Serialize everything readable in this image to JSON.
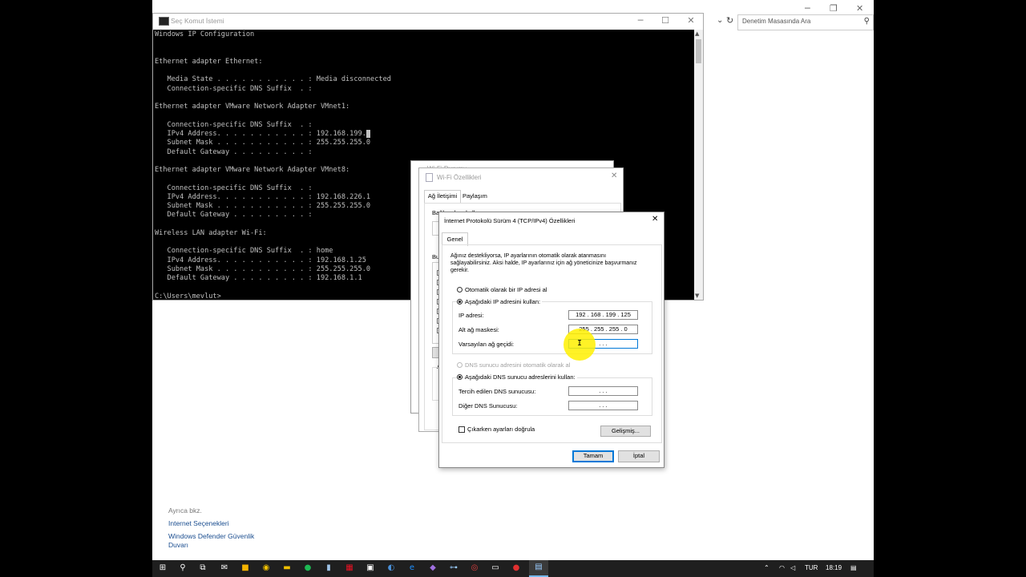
{
  "control_panel": {
    "search_placeholder": "Denetim Masasında Ara",
    "see_also_title": "Ayrıca bkz.",
    "see_also_links": [
      "Internet Seçenekleri",
      "Windows Defender Güvenlik",
      "Duvarı"
    ]
  },
  "cmd": {
    "title": "Seç Komut İstemi",
    "lines": [
      "Windows IP Configuration",
      "",
      "",
      "Ethernet adapter Ethernet:",
      "",
      "   Media State . . . . . . . . . . . : Media disconnected",
      "   Connection-specific DNS Suffix  . :",
      "",
      "Ethernet adapter VMware Network Adapter VMnet1:",
      "",
      "   Connection-specific DNS Suffix  . :",
      "   IPv4 Address. . . . . . . . . . . : 192.168.199.",
      "   Subnet Mask . . . . . . . . . . . : 255.255.255.0",
      "   Default Gateway . . . . . . . . . :",
      "",
      "Ethernet adapter VMware Network Adapter VMnet8:",
      "",
      "   Connection-specific DNS Suffix  . :",
      "   IPv4 Address. . . . . . . . . . . : 192.168.226.1",
      "   Subnet Mask . . . . . . . . . . . : 255.255.255.0",
      "   Default Gateway . . . . . . . . . :",
      "",
      "Wireless LAN adapter Wi-Fi:",
      "",
      "   Connection-specific DNS Suffix  . : home",
      "   IPv4 Address. . . . . . . . . . . : 192.168.1.25",
      "   Subnet Mask . . . . . . . . . . . : 255.255.255.0",
      "   Default Gateway . . . . . . . . . : 192.168.1.1",
      "",
      "C:\\Users\\mevlut>"
    ]
  },
  "wifi_status": {
    "title": "Wi-Fi Durumu"
  },
  "wifi_props": {
    "title": "Wi-Fi Özellikleri",
    "tabs": [
      "Ağ İletişimi",
      "Paylaşım"
    ],
    "connect_label": "Bağlanırken kullan:",
    "items_label": "Bu",
    "desc_label": "A"
  },
  "tcp": {
    "title": "İnternet Protokolü Sürüm 4 (TCP/IPv4) Özellikleri",
    "tab": "Genel",
    "description": [
      "Ağınız destekliyorsa, IP ayarlarının otomatik olarak atanmasını",
      "sağlayabilirsiniz. Aksi halde, IP ayarlarınız için ağ yöneticinize başvurmanız",
      "gerekir."
    ],
    "radio_auto_ip": "Otomatik olarak bir IP adresi al",
    "radio_manual_ip": "Aşağıdaki IP adresini kullan:",
    "ip_label": "IP adresi:",
    "ip_value": "192 . 168 . 199 . 125",
    "mask_label": "Alt ağ maskesi:",
    "mask_value": "255 . 255 . 255 .  0",
    "gateway_label": "Varsayılan ağ geçidi:",
    "gateway_value": "     .      .      .",
    "radio_auto_dns": "DNS sunucu adresini otomatik olarak al",
    "radio_manual_dns": "Aşağıdaki DNS sunucu adreslerini kullan:",
    "pref_dns_label": "Tercih edilen DNS sunucusu:",
    "pref_dns_value": "     .      .      .",
    "alt_dns_label": "Diğer DNS Sunucusu:",
    "alt_dns_value": "     .      .      .",
    "validate_label": "Çıkarken ayarları doğrula",
    "advanced_button": "Gelişmiş...",
    "ok_button": "Tamam",
    "cancel_button": "İptal"
  },
  "taskbar": {
    "lang": "TUR",
    "time": "18:19"
  },
  "colors": {
    "accent": "#0078d7",
    "taskbar": "#1f1f1f",
    "highlight": "#ffee00"
  }
}
